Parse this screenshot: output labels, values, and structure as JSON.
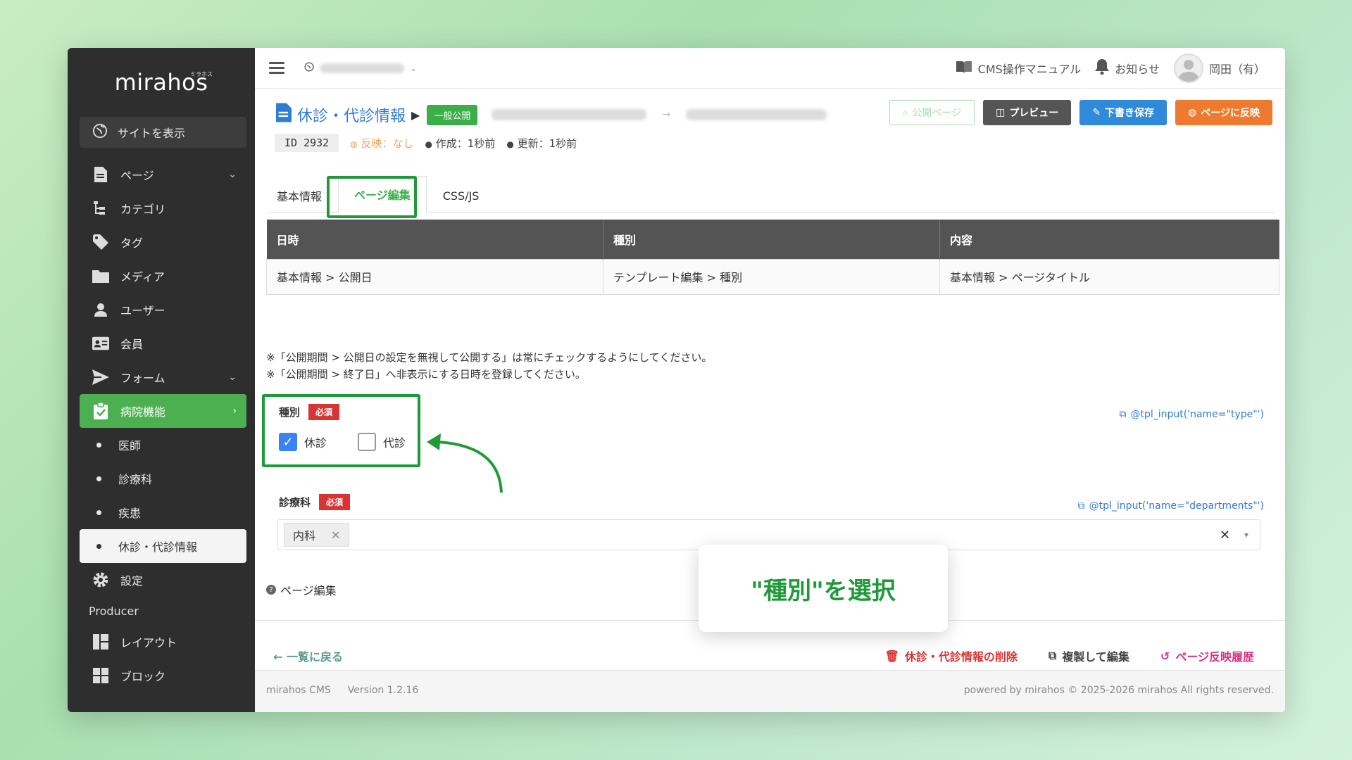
{
  "sidebar": {
    "logo": "mirahos",
    "logo_kana": "ミラホス",
    "view_site": "サイトを表示",
    "items": [
      {
        "label": "ページ",
        "icon": "document-icon"
      },
      {
        "label": "カテゴリ",
        "icon": "category-tree-icon"
      },
      {
        "label": "タグ",
        "icon": "tag-icon"
      },
      {
        "label": "メディア",
        "icon": "folder-icon"
      },
      {
        "label": "ユーザー",
        "icon": "user-icon"
      },
      {
        "label": "会員",
        "icon": "member-card-icon"
      },
      {
        "label": "フォーム",
        "icon": "send-icon"
      },
      {
        "label": "病院機能",
        "icon": "clipboard-check-icon"
      }
    ],
    "sub_items": [
      "医師",
      "診療科",
      "疾患",
      "休診・代診情報"
    ],
    "settings": "設定",
    "producer_label": "Producer",
    "producer_items": [
      "レイアウト",
      "ブロック"
    ]
  },
  "topbar": {
    "manual": "CMS操作マニュアル",
    "notice": "お知らせ",
    "user": "岡田（有）"
  },
  "header": {
    "title": "休診・代診情報",
    "status": "一般公開",
    "id": "ID 2932",
    "reflect": "反映：なし",
    "created": "作成：1秒前",
    "updated": "更新：1秒前",
    "btn_public": "公開ページ",
    "btn_preview": "プレビュー",
    "btn_draft": "下書き保存",
    "btn_publish": "ページに反映"
  },
  "tabs": [
    "基本情報",
    "ページ編集",
    "CSS/JS"
  ],
  "table": {
    "headers": [
      "日時",
      "種別",
      "内容"
    ],
    "row": [
      "基本情報 > 公開日",
      "テンプレート編集 > 種別",
      "基本情報 > ページタイトル"
    ]
  },
  "notes": [
    "※「公開期間 > 公開日の設定を無視して公開する」は常にチェックするようにしてください。",
    "※「公開期間 > 終了日」へ非表示にする日時を登録してください。"
  ],
  "field_type": {
    "label": "種別",
    "required": "必須",
    "options": [
      {
        "label": "休診",
        "checked": true
      },
      {
        "label": "代診",
        "checked": false
      }
    ],
    "tpl": "@tpl_input('name=\"type\"')"
  },
  "field_dept": {
    "label": "診療科",
    "required": "必須",
    "chip": "内科",
    "tpl": "@tpl_input('name=\"departments\"')"
  },
  "help": "ページ編集",
  "footer_actions": {
    "back": "← 一覧に戻る",
    "delete": "休診・代診情報の削除",
    "duplicate": "複製して編集",
    "history": "ページ反映履歴"
  },
  "page_footer": {
    "app": "mirahos CMS",
    "version": "Version 1.2.16",
    "copyright": "powered by mirahos © 2025-2026 mirahos All rights reserved."
  },
  "callout": "\"種別\"を選択",
  "colors": {
    "accent": "#4caf50",
    "highlight": "#1f9a3a",
    "link": "#2f7bd6"
  }
}
